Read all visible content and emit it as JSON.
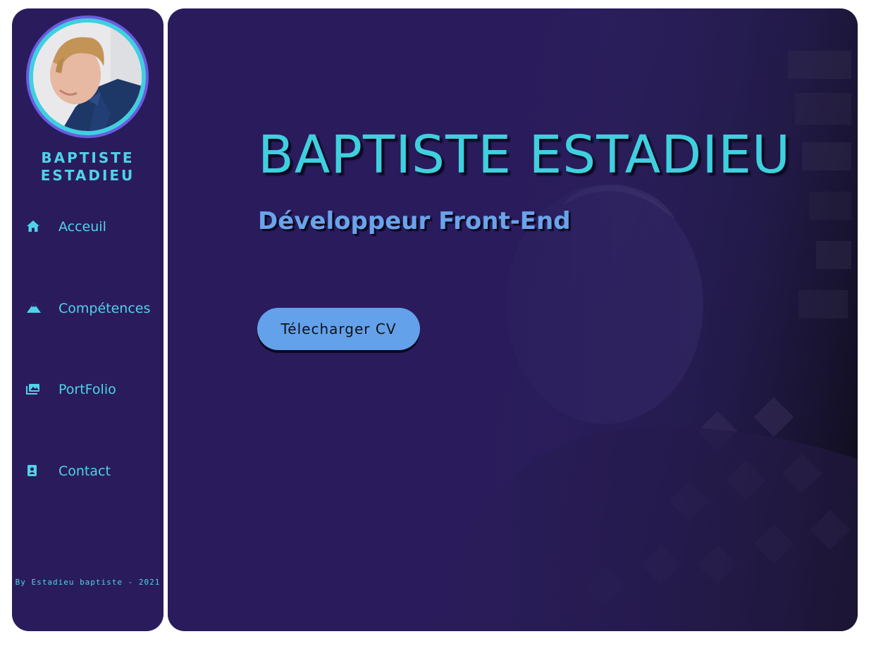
{
  "sidebar": {
    "name": "BAPTISTE ESTADIEU",
    "nav": [
      {
        "label": "Acceuil",
        "icon": "home-icon"
      },
      {
        "label": "Compétences",
        "icon": "mountain-icon"
      },
      {
        "label": "PortFolio",
        "icon": "images-icon"
      },
      {
        "label": "Contact",
        "icon": "contact-card-icon"
      }
    ],
    "footer": "By Estadieu baptiste - 2021"
  },
  "hero": {
    "title": "BAPTISTE ESTADIEU",
    "subtitle": "Développeur Front-End",
    "cta_label": "Télecharger CV"
  },
  "colors": {
    "panel": "#2a1c5c",
    "accent_cyan": "#3fd0df",
    "accent_blue": "#63a1ea",
    "avatar_ring": "#6b5be0"
  }
}
